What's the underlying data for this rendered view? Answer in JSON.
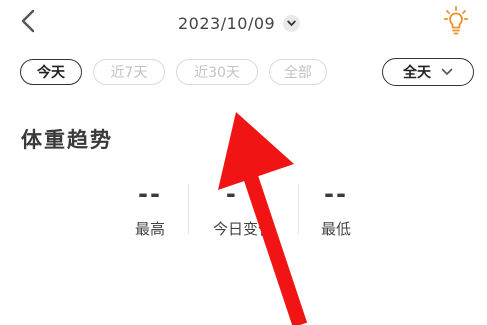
{
  "header": {
    "date": "2023/10/09",
    "back_icon": "chevron-left-icon",
    "date_dropdown_icon": "chevron-down-icon",
    "tip_icon": "lightbulb-icon",
    "tip_icon_color": "#f0902a"
  },
  "filters": {
    "chips": [
      {
        "label": "今天",
        "active": true
      },
      {
        "label": "近7天",
        "active": false
      },
      {
        "label": "近30天",
        "active": false
      },
      {
        "label": "全部",
        "active": false
      }
    ],
    "period_select": {
      "value": "全天",
      "icon": "chevron-down-icon"
    }
  },
  "section": {
    "title": "体重趋势"
  },
  "stats": [
    {
      "value": "--",
      "label": "最高"
    },
    {
      "value": "- -",
      "label": "今日变化"
    },
    {
      "value": "--",
      "label": "最低"
    }
  ],
  "annotation": {
    "arrow_color": "#f01414"
  }
}
